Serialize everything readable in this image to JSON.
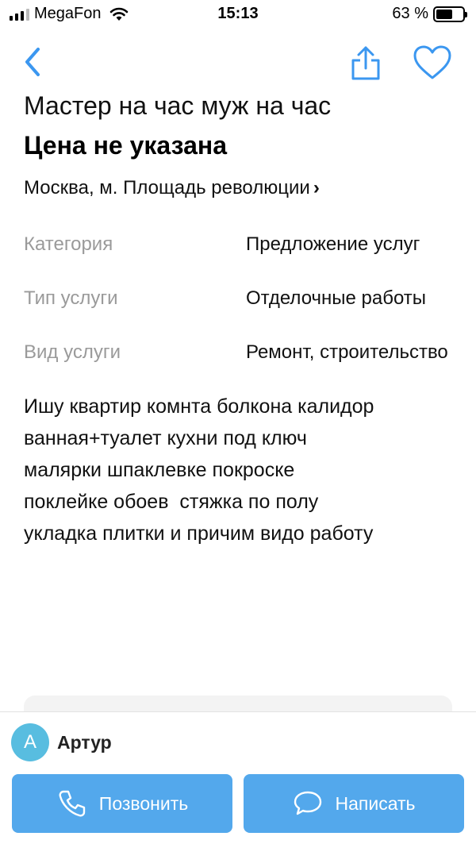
{
  "status_bar": {
    "carrier": "MegaFon",
    "time": "15:13",
    "battery_percent": "63 %",
    "battery_level": 0.63
  },
  "nav": {
    "back_icon": "chevron-left-icon",
    "share_icon": "share-icon",
    "favorite_icon": "heart-icon",
    "accent_color": "#3b97f0"
  },
  "listing": {
    "title": "Мастер на час муж на час",
    "price": "Цена не указана",
    "location": "Москва, м. Площадь революции",
    "location_chevron": "›",
    "params": [
      {
        "label": "Категория",
        "value": "Предложение услуг"
      },
      {
        "label": "Тип услуги",
        "value": "Отделочные работы"
      },
      {
        "label": "Вид услуги",
        "value": "Ремонт, строительство"
      }
    ],
    "description": "Ишу квартир комнта болкона калидор\nванная+туалет кухни под ключ\nмалярки шпаклевке покроске\nпоклейке обоев  стяжка по полу\nукладка плитки и причим видо работу"
  },
  "seller": {
    "avatar_letter": "А",
    "name": "Артур",
    "avatar_color": "#58bde0"
  },
  "actions": {
    "call_label": "Позвонить",
    "call_icon": "phone-icon",
    "write_label": "Написать",
    "write_icon": "chat-bubble-icon",
    "button_color": "#53a8ec"
  }
}
